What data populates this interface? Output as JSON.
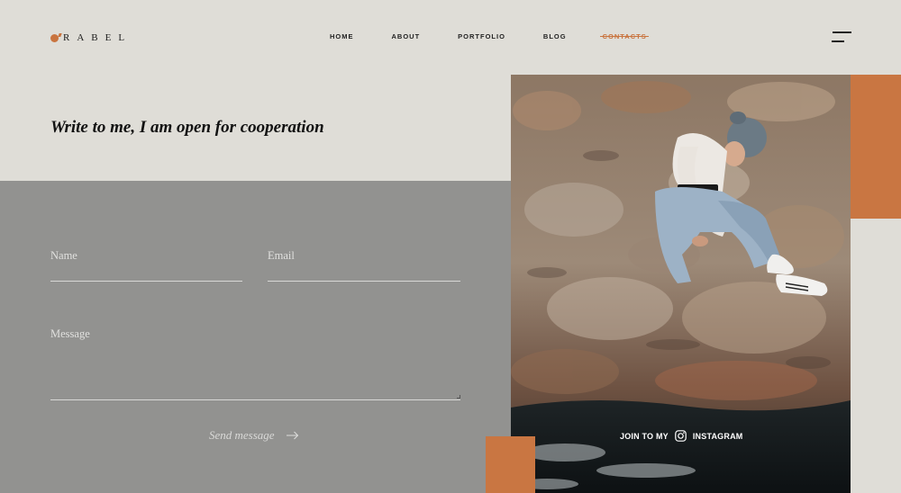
{
  "header": {
    "logo_text": "RABEL",
    "nav": [
      "HOME",
      "ABOUT",
      "PORTFOLIO",
      "BLOG",
      "CONTACTS"
    ],
    "active_nav": "CONTACTS"
  },
  "hero": {
    "heading": "Write to me, I am open for cooperation"
  },
  "form": {
    "name_placeholder": "Name",
    "email_placeholder": "Email",
    "message_placeholder": "Message",
    "send_label": "Send message"
  },
  "instagram": {
    "prefix": "JOIN TO MY",
    "icon": "instagram-icon",
    "label": "INSTAGRAM"
  },
  "colors": {
    "accent": "#c97642",
    "background": "#dfddd7",
    "form_panel": "#929290"
  },
  "icons": [
    "logo-dot-icon",
    "menu-icon",
    "arrow-right-icon",
    "instagram-icon"
  ]
}
